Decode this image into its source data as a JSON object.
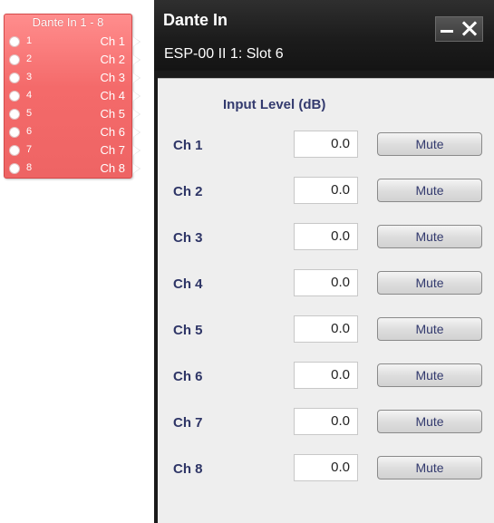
{
  "node": {
    "title": "Dante In 1 - 8",
    "pins": [
      {
        "num": "1",
        "out": "Ch 1"
      },
      {
        "num": "2",
        "out": "Ch 2"
      },
      {
        "num": "3",
        "out": "Ch 3"
      },
      {
        "num": "4",
        "out": "Ch 4"
      },
      {
        "num": "5",
        "out": "Ch 5"
      },
      {
        "num": "6",
        "out": "Ch 6"
      },
      {
        "num": "7",
        "out": "Ch 7"
      },
      {
        "num": "8",
        "out": "Ch 8"
      }
    ]
  },
  "panel": {
    "title": "Dante In",
    "subtitle": "ESP-00 II 1: Slot 6",
    "column_header": "Input Level (dB)",
    "mute_label": "Mute",
    "channels": [
      {
        "label": "Ch 1",
        "value": "0.0"
      },
      {
        "label": "Ch 2",
        "value": "0.0"
      },
      {
        "label": "Ch 3",
        "value": "0.0"
      },
      {
        "label": "Ch 4",
        "value": "0.0"
      },
      {
        "label": "Ch 5",
        "value": "0.0"
      },
      {
        "label": "Ch 6",
        "value": "0.0"
      },
      {
        "label": "Ch 7",
        "value": "0.0"
      },
      {
        "label": "Ch 8",
        "value": "0.0"
      }
    ]
  }
}
